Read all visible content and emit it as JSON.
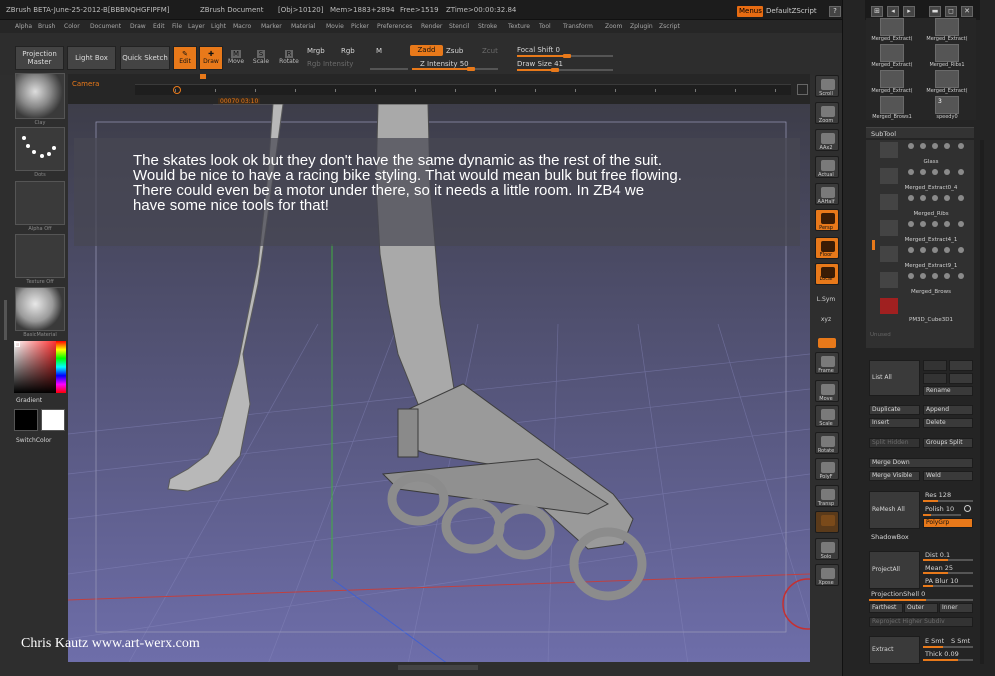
{
  "window": {
    "title": "ZBrush BETA-June-25-2012-B[BBBNQHGFIPFM]",
    "document": "ZBrush Document",
    "obj": "[Obj>10120]",
    "mem": "Mem>1883+2894",
    "free": "Free>1519",
    "ztime": "ZTime>00:00:32.84",
    "menus_label": "Menus",
    "script_label": "DefaultZScript"
  },
  "menubar": [
    "Alpha",
    "Brush",
    "Color",
    "Document",
    "Draw",
    "Edit",
    "File",
    "Layer",
    "Light",
    "Macro",
    "Marker",
    "Material",
    "Movie",
    "Picker",
    "Preferences",
    "Render",
    "Stencil",
    "Stroke",
    "Texture",
    "Tool",
    "Transform",
    "Zoom",
    "Zplugin",
    "Zscript"
  ],
  "toolbar": {
    "projection_master": "Projection Master",
    "light_box": "Light Box",
    "quick_sketch": "Quick Sketch",
    "edit": "Edit",
    "draw": "Draw",
    "move": "Move",
    "scale": "Scale",
    "rotate": "Rotate",
    "mrgb": "Mrgb",
    "rgb": "Rgb",
    "m": "M",
    "rgb_intensity": "Rgb Intensity",
    "zadd": "Zadd",
    "zsub": "Zsub",
    "zcut": "Zcut",
    "z_intensity": "Z Intensity 50",
    "focal_shift": "Focal Shift 0",
    "draw_size": "Draw Size 41",
    "z_intensity_value": 50,
    "focal_shift_value": 0,
    "draw_size_value": 41
  },
  "timeline": {
    "label": "Camera",
    "frame_readout": "00070",
    "time_readout": "03:10"
  },
  "left_shelf": {
    "brush": "Clay",
    "stroke": "Dots",
    "alpha": "Alpha Off",
    "texture": "Texture Off",
    "material": "BasicMaterial",
    "gradient": "Gradient",
    "switch_color": "SwitchColor"
  },
  "note": {
    "lines": [
      "The skates look ok but they don't have the same dynamic as the rest of the suit.",
      "Would be nice to have a racing bike styling. That would mean bulk but free flowing.",
      "There could even be a motor under there, so it needs a little room. In ZB4 we",
      "have some nice tools for that!"
    ]
  },
  "credit": "Chris Kautz www.art-werx.com",
  "right_strip": [
    "Scroll",
    "Zoom",
    "AAHalf",
    "Actual",
    "AAHalf",
    "Persp",
    "Floor",
    "Local",
    "L.Sym",
    "Frame",
    "Move",
    "Scale",
    "Rotate",
    "PolyF",
    "Transp",
    "Solo",
    "Xpose"
  ],
  "right_strip_top": [
    "Scroll",
    "Zoom",
    "AAx2",
    "Actual",
    "AAHalf",
    "Persp",
    "Floor",
    "Local",
    "L.Sym",
    "xyz",
    "Frame",
    "Move",
    "Scale",
    "Rotate",
    "PolyF",
    "Transp",
    "Ghost",
    "Solo",
    "Xpose"
  ],
  "tool_grid": [
    "Merged_Extract(",
    "Merged_Extract(",
    "Merged_Extract(",
    "Merged_Ribs1",
    "Merged_Extract(",
    "Merged_Extract(",
    "Merged_Brows1",
    "speedy0"
  ],
  "tool_grid_badge": "3",
  "subtool": {
    "header": "SubTool",
    "items": [
      "Glass",
      "Merged_Extract0_4",
      "Merged_Ribs",
      "Merged_Extract4_1",
      "Merged_Extract9_1",
      "Merged_Brows",
      "PM3D_Cube3D1",
      "Unused"
    ],
    "list_all": "List  All",
    "rename": "Rename",
    "duplicate": "Duplicate",
    "append": "Append",
    "insert": "Insert",
    "delete": "Delete",
    "split_hidden": "Split Hidden",
    "groups_split": "Groups Split",
    "merge_down": "Merge Down",
    "merge_visible": "Merge Visible",
    "weld": "Weld",
    "remesh_all": "ReMesh All",
    "res": "Res 128",
    "polish": "Polish 10",
    "polygrp": "PolyGrp",
    "shadowbox": "ShadowBox",
    "project_all": "ProjectAll",
    "dist": "Dist 0.1",
    "mean": "Mean 25",
    "pa_blur": "PA Blur 10",
    "projection_shell": "ProjectionShell 0",
    "farthest": "Farthest",
    "outer": "Outer",
    "inner": "Inner",
    "reproject": "Reproject Higher Subdiv",
    "extract": "Extract",
    "e_smt": "E Smt",
    "s_smt": "S Smt",
    "thick": "Thick 0.09"
  }
}
